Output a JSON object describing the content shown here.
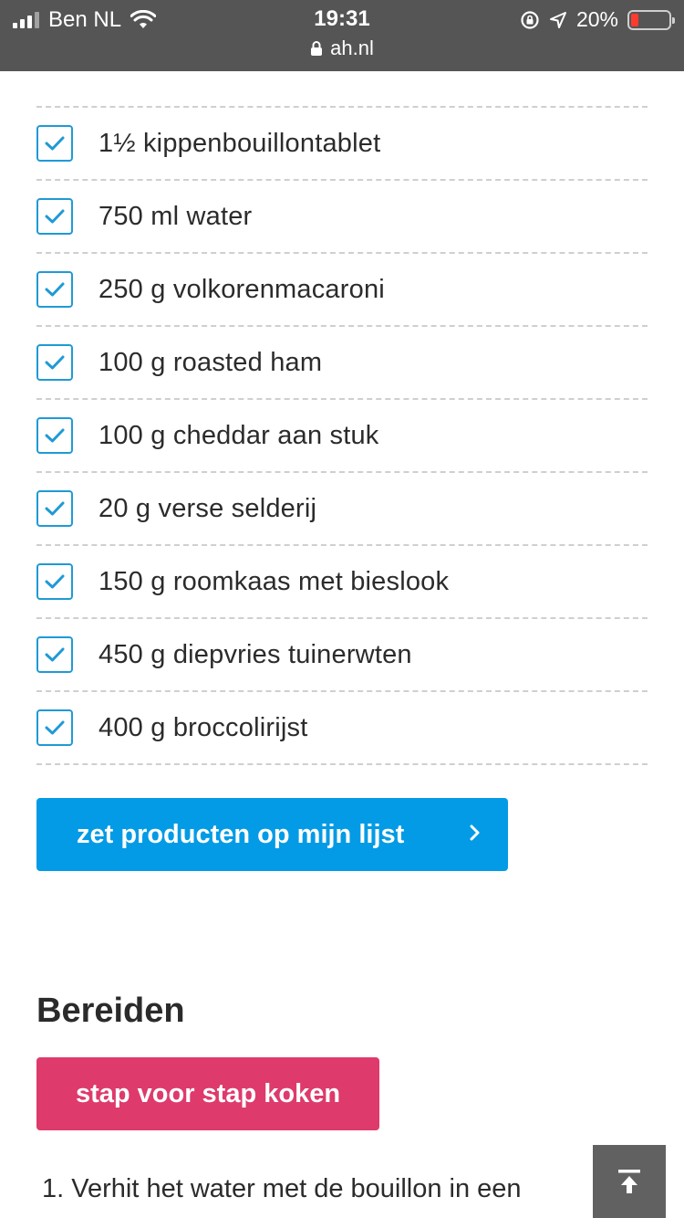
{
  "status_bar": {
    "carrier": "Ben NL",
    "time": "19:31",
    "url": "ah.nl",
    "battery": "20%"
  },
  "ingredients": [
    {
      "label": "1½ kippenbouillontablet",
      "checked": true
    },
    {
      "label": "750 ml water",
      "checked": true
    },
    {
      "label": "250 g volkorenmacaroni",
      "checked": true
    },
    {
      "label": "100 g roasted ham",
      "checked": true
    },
    {
      "label": "100 g cheddar aan stuk",
      "checked": true
    },
    {
      "label": "20 g verse selderij",
      "checked": true
    },
    {
      "label": "150 g roomkaas met bieslook",
      "checked": true
    },
    {
      "label": "450 g diepvries tuinerwten",
      "checked": true
    },
    {
      "label": "400 g broccolirijst",
      "checked": true
    }
  ],
  "list_button": {
    "label": "zet producten op mijn lijst"
  },
  "prepare": {
    "title": "Bereiden",
    "cook_button": "stap voor stap koken",
    "first_step": "1. Verhit het water met de bouillon in een"
  },
  "colors": {
    "accent_blue": "#039be5",
    "accent_pink": "#de3a6c",
    "status_bar": "#555555"
  }
}
